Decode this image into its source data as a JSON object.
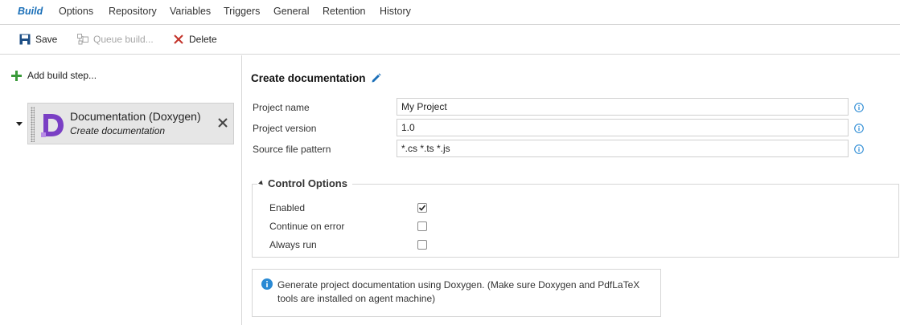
{
  "tabs": [
    {
      "label": "Build",
      "active": true
    },
    {
      "label": "Options"
    },
    {
      "label": "Repository"
    },
    {
      "label": "Variables"
    },
    {
      "label": "Triggers"
    },
    {
      "label": "General"
    },
    {
      "label": "Retention"
    },
    {
      "label": "History"
    }
  ],
  "toolbar": {
    "save_label": "Save",
    "queue_label": "Queue build...",
    "delete_label": "Delete"
  },
  "left": {
    "add_step_label": "Add build step...",
    "step": {
      "title": "Documentation (Doxygen)",
      "subtitle": "Create documentation",
      "icon": "doxygen-d-logo"
    }
  },
  "main": {
    "title": "Create documentation",
    "fields": [
      {
        "label": "Project name",
        "value": "My Project"
      },
      {
        "label": "Project version",
        "value": "1.0"
      },
      {
        "label": "Source file pattern",
        "value": "*.cs *.ts *.js"
      }
    ],
    "control_options": {
      "title": "Control Options",
      "options": [
        {
          "label": "Enabled",
          "checked": true
        },
        {
          "label": "Continue on error",
          "checked": false
        },
        {
          "label": "Always run",
          "checked": false
        }
      ]
    },
    "help_text": "Generate project documentation using Doxygen. (Make sure Doxygen and PdfLaTeX tools are installed on agent machine)"
  },
  "colors": {
    "accent": "#1a6fb8",
    "add_green": "#3a9a3a",
    "delete_red": "#c3342a",
    "doxygen_purple": "#7a3fc4",
    "info_blue": "#2a8ad4"
  }
}
